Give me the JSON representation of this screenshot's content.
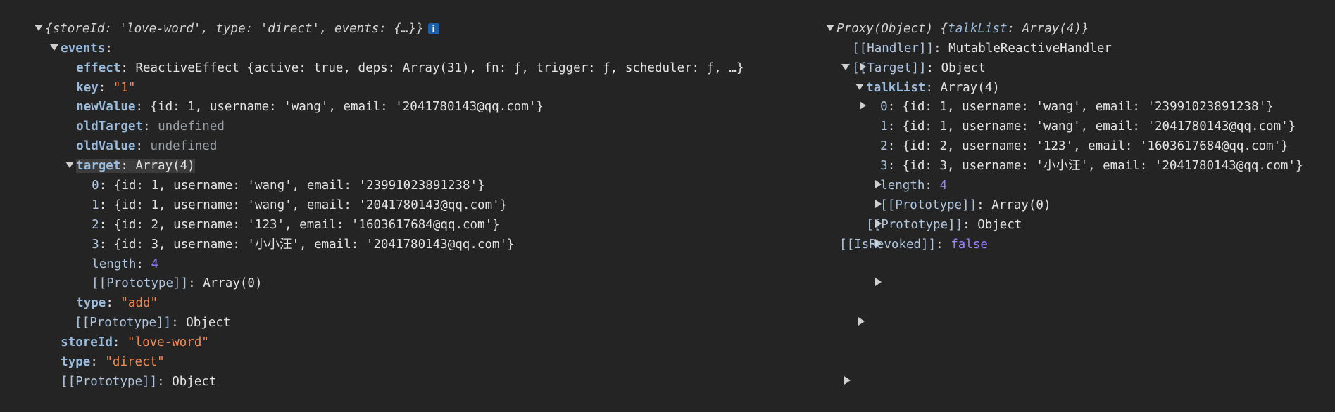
{
  "left": {
    "root_summary": "{storeId: 'love-word', type: 'direct', events: {…}}",
    "info_glyph": "i",
    "events_key": "events",
    "effect_key": "effect",
    "effect_value": "ReactiveEffect {active: true, deps: Array(31), fn: ƒ, trigger: ƒ, scheduler: ƒ, …}",
    "key_key": "key",
    "key_value": "\"1\"",
    "newValue_key": "newValue",
    "newValue_value": "{id: 1, username: 'wang', email: '2041780143@qq.com'}",
    "oldTarget_key": "oldTarget",
    "oldTarget_value": "undefined",
    "oldValue_key": "oldValue",
    "oldValue_value": "undefined",
    "target_key": "target",
    "target_value": "Array(4)",
    "target_items": [
      {
        "idx": "0",
        "value": "{id: 1, username: 'wang', email: '23991023891238'}"
      },
      {
        "idx": "1",
        "value": "{id: 1, username: 'wang', email: '2041780143@qq.com'}"
      },
      {
        "idx": "2",
        "value": "{id: 2, username: '123', email: '1603617684@qq.com'}"
      },
      {
        "idx": "3",
        "value": "{id: 3, username: '小小汪', email: '2041780143@qq.com'}"
      }
    ],
    "length_key": "length",
    "length_value": "4",
    "proto_array_key": "[[Prototype]]",
    "proto_array_value": "Array(0)",
    "type_inner_key": "type",
    "type_inner_value": "\"add\"",
    "proto_obj_key": "[[Prototype]]",
    "proto_obj_value": "Object",
    "storeId_key": "storeId",
    "storeId_value": "\"love-word\"",
    "type_key": "type",
    "type_value": "\"direct\"",
    "proto_root_key": "[[Prototype]]",
    "proto_root_value": "Object"
  },
  "right": {
    "root_prefix": "Proxy(Object) ",
    "root_summary_key": "talkList",
    "root_summary_value": "Array(4)",
    "handler_key": "[[Handler]]",
    "handler_value": "MutableReactiveHandler",
    "target_key": "[[Target]]",
    "target_value": "Object",
    "talkList_key": "talkList",
    "talkList_value": "Array(4)",
    "items": [
      {
        "idx": "0",
        "value": "{id: 1, username: 'wang', email: '23991023891238'}"
      },
      {
        "idx": "1",
        "value": "{id: 1, username: 'wang', email: '2041780143@qq.com'}"
      },
      {
        "idx": "2",
        "value": "{id: 2, username: '123', email: '1603617684@qq.com'}"
      },
      {
        "idx": "3",
        "value": "{id: 3, username: '小小汪', email: '2041780143@qq.com'}"
      }
    ],
    "length_key": "length",
    "length_value": "4",
    "proto_array_key": "[[Prototype]]",
    "proto_array_value": "Array(0)",
    "proto_obj_key": "[[Prototype]]",
    "proto_obj_value": "Object",
    "revoked_key": "[[IsRevoked]]",
    "revoked_value": "false"
  },
  "colors": {
    "background": "#242424",
    "key": "#9bbbdc",
    "string": "#f28b54",
    "number": "#9980ff",
    "info_badge": "#1d5fa8"
  }
}
